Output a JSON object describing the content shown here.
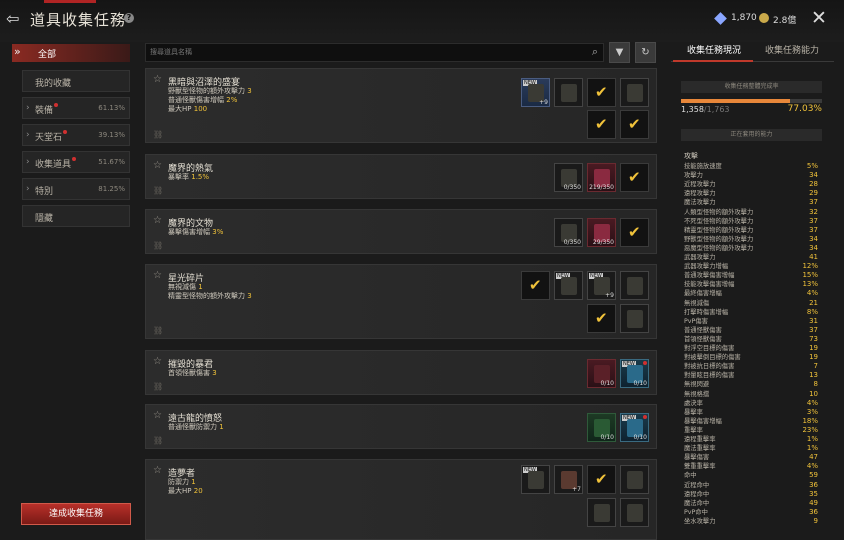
{
  "header": {
    "title": "道具收集任務",
    "currency_gem": "1,870",
    "currency_coin": "2.8億"
  },
  "sidebar": {
    "all_label": "全部",
    "items": [
      {
        "label": "我的收藏",
        "pct": ""
      },
      {
        "label": "裝備",
        "pct": "61.13%"
      },
      {
        "label": "天堂石",
        "pct": "39.13%"
      },
      {
        "label": "收集道具",
        "pct": "51.67%"
      },
      {
        "label": "特別",
        "pct": "81.25%"
      },
      {
        "label": "隱藏",
        "pct": ""
      }
    ],
    "achieve_button": "達成收集任務"
  },
  "search": {
    "placeholder": "搜尋道具名稱"
  },
  "quests": [
    {
      "name": "黑暗與沼澤的盛宴",
      "stats": [
        [
          "野獸型怪物的額外攻擊力",
          "3"
        ],
        [
          "普通怪獸傷害增幅",
          "2%"
        ],
        [
          "最大HP",
          "100"
        ]
      ]
    },
    {
      "name": "魔界的熱氣",
      "stats": [
        [
          "暴擊率",
          "1.5%"
        ]
      ],
      "counts": [
        "0/350",
        "219/350"
      ]
    },
    {
      "name": "魔界的文物",
      "stats": [
        [
          "暴擊傷害增幅",
          "3%"
        ]
      ],
      "counts": [
        "0/350",
        "29/350"
      ]
    },
    {
      "name": "星光碎片",
      "stats": [
        [
          "無視減傷",
          "1"
        ],
        [
          "精靈型怪物的額外攻擊力",
          "3"
        ]
      ]
    },
    {
      "name": "摧毀的暴君",
      "stats": [
        [
          "首領怪獸傷害",
          "3"
        ]
      ],
      "counts": [
        "0/10",
        "0/10"
      ]
    },
    {
      "name": "遠古龍的憤怒",
      "stats": [
        [
          "普通怪獸防禦力",
          "1"
        ]
      ],
      "counts": [
        "0/10",
        "0/10"
      ]
    },
    {
      "name": "造夢者",
      "stats": [
        [
          "防禦力",
          "1"
        ],
        [
          "最大HP",
          "20"
        ]
      ]
    }
  ],
  "enhance": [
    "+9",
    "+9",
    "+7"
  ],
  "right_panel": {
    "tab_status": "收集任務現況",
    "tab_ability": "收集任務能力",
    "overall_title": "收集任務整體完成率",
    "progress_current": "1,358",
    "progress_total": "1,763",
    "progress_pct": "77.03%",
    "progress_fraction": 0.7703,
    "applied_title": "正在套用的能力",
    "category": "攻擊",
    "stats": [
      [
        "技能施放速度",
        "5%"
      ],
      [
        "攻擊力",
        "34"
      ],
      [
        "近程攻擊力",
        "28"
      ],
      [
        "遠程攻擊力",
        "29"
      ],
      [
        "魔法攻擊力",
        "37"
      ],
      [
        "人類型怪物的額外攻擊力",
        "32"
      ],
      [
        "不死型怪物的額外攻擊力",
        "37"
      ],
      [
        "精靈型怪物的額外攻擊力",
        "37"
      ],
      [
        "野獸型怪物的額外攻擊力",
        "34"
      ],
      [
        "惡魔型怪物的額外攻擊力",
        "34"
      ],
      [
        "武器攻擊力",
        "41"
      ],
      [
        "武器攻擊力增幅",
        "12%"
      ],
      [
        "普通攻擊傷害增幅",
        "15%"
      ],
      [
        "技能攻擊傷害增幅",
        "13%"
      ],
      [
        "最終傷害增幅",
        "4%"
      ],
      [
        "無視減傷",
        "21"
      ],
      [
        "打擊時傷害增幅",
        "8%"
      ],
      [
        "PvP傷害",
        "31"
      ],
      [
        "普通怪獸傷害",
        "37"
      ],
      [
        "首領怪獸傷害",
        "73"
      ],
      [
        "對浮空目標的傷害",
        "19"
      ],
      [
        "對被擊倒目標的傷害",
        "19"
      ],
      [
        "對被抗日標的傷害",
        "7"
      ],
      [
        "對暈眩目標的傷害",
        "13"
      ],
      [
        "無視閃避",
        "8"
      ],
      [
        "無視格擋",
        "10"
      ],
      [
        "處決率",
        "4%"
      ],
      [
        "暴擊率",
        "3%"
      ],
      [
        "暴擊傷害增幅",
        "18%"
      ],
      [
        "重擊率",
        "23%"
      ],
      [
        "遠程重擊率",
        "1%"
      ],
      [
        "魔法重擊率",
        "1%"
      ],
      [
        "暴擊傷害",
        "47"
      ],
      [
        "雙重重擊率",
        "4%"
      ],
      [
        "命中",
        "59"
      ],
      [
        "近程命中",
        "36"
      ],
      [
        "遠程命中",
        "35"
      ],
      [
        "魔法命中",
        "49"
      ],
      [
        "PvP命中",
        "36"
      ],
      [
        "坐水攻擊力",
        "9"
      ]
    ]
  }
}
